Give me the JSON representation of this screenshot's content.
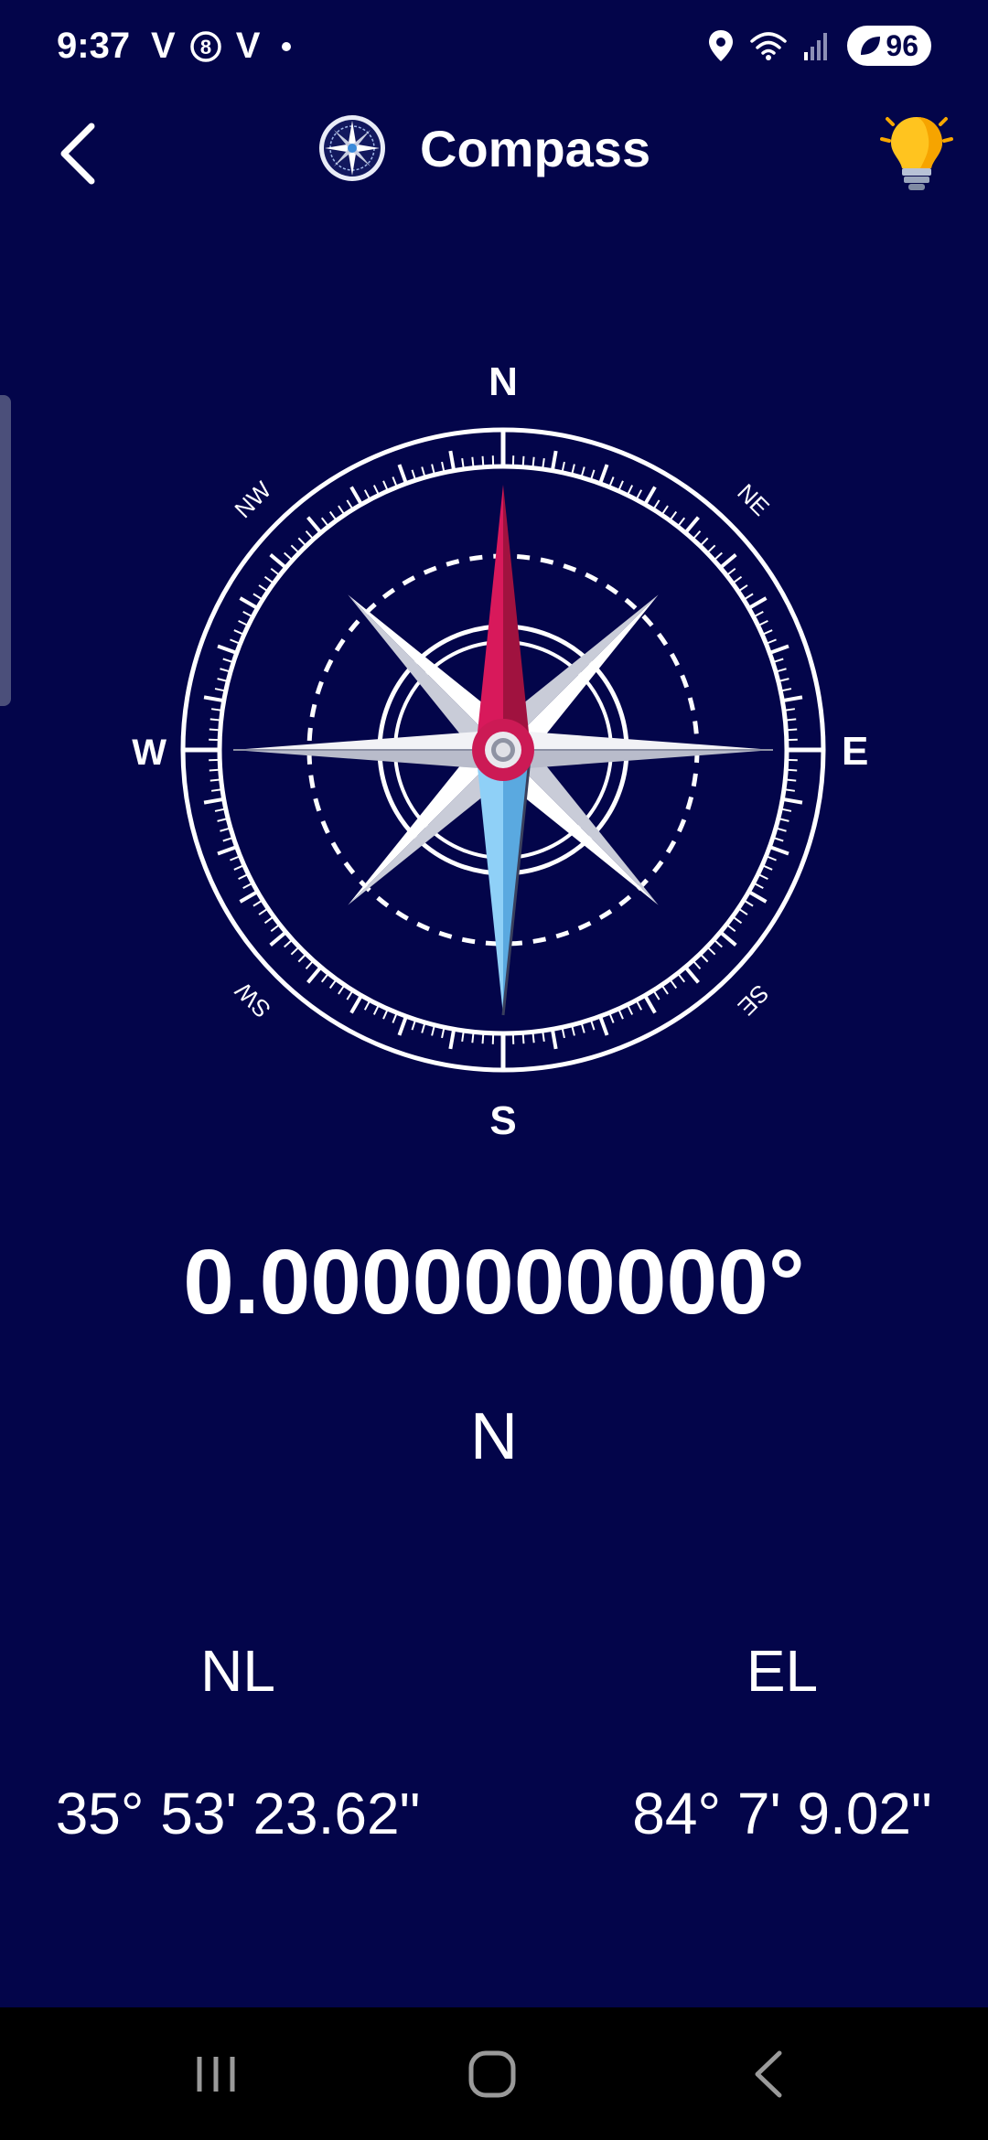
{
  "status_bar": {
    "time": "9:37",
    "left_icons": [
      "V",
      "V"
    ],
    "battery": "96"
  },
  "header": {
    "title": "Compass"
  },
  "compass_labels": {
    "north": "N",
    "south": "S",
    "east": "E",
    "west": "W",
    "northeast": "NE",
    "northwest": "NW",
    "southeast": "SE",
    "southwest": "SW"
  },
  "readout": {
    "heading": "0.0000000000°",
    "direction": "N"
  },
  "coordinates": {
    "lat_label": "NL",
    "lat_value": "35° 53' 23.62\"",
    "lon_label": "EL",
    "lon_value": "84° 7' 9.02\""
  },
  "colors": {
    "background": "#03054a",
    "needle_north": "#d8195b",
    "needle_south": "#7cc3f0"
  }
}
